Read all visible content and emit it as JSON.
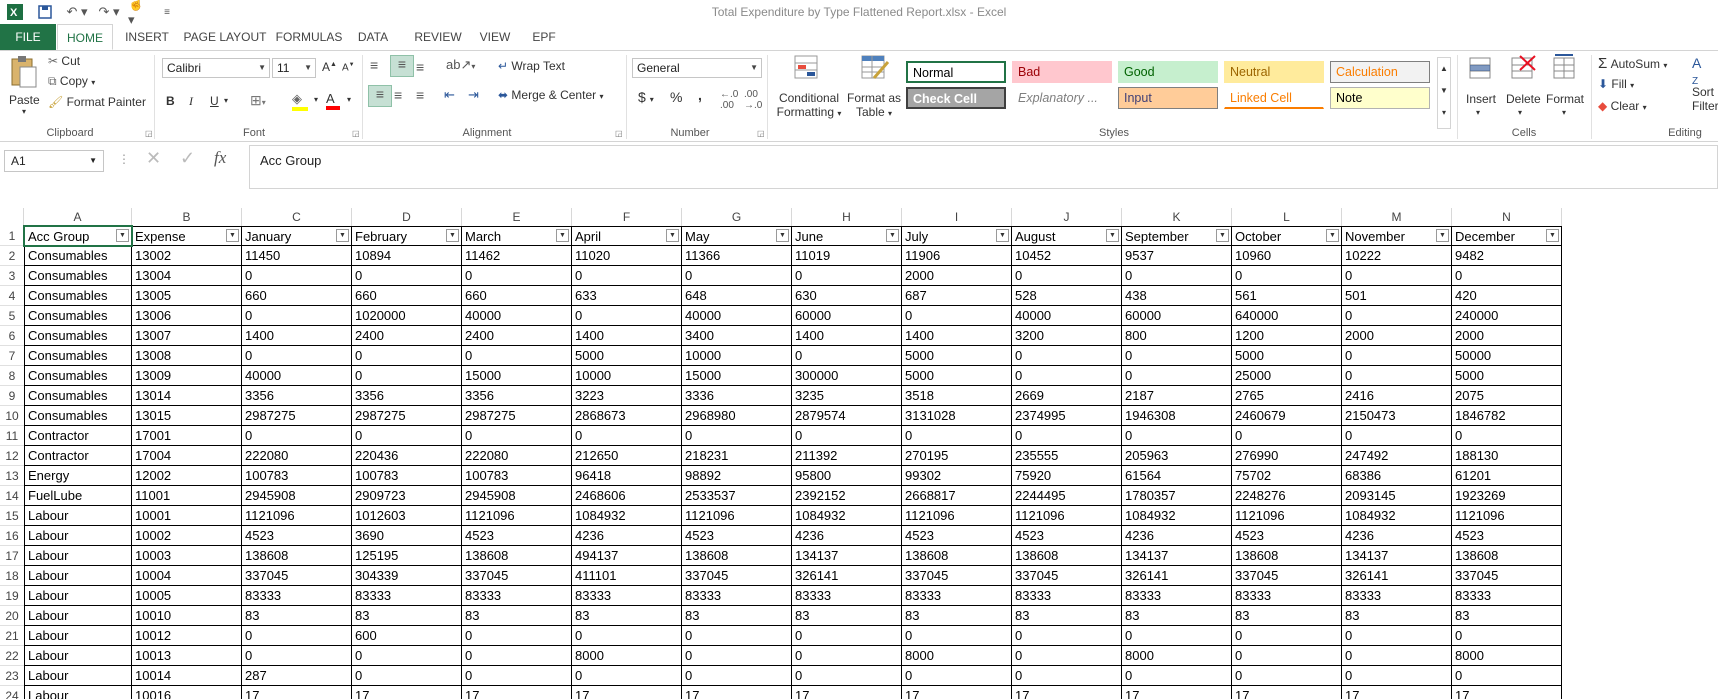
{
  "window_title": "Total Expenditure by Type Flattened Report.xlsx - Excel",
  "tabs": [
    "FILE",
    "HOME",
    "INSERT",
    "PAGE LAYOUT",
    "FORMULAS",
    "DATA",
    "REVIEW",
    "VIEW",
    "EPF"
  ],
  "clipboard": {
    "paste": "Paste",
    "cut": "Cut",
    "copy": "Copy",
    "format_painter": "Format Painter",
    "label": "Clipboard"
  },
  "font": {
    "name": "Calibri",
    "size": "11",
    "label": "Font",
    "bold": "B",
    "italic": "I",
    "underline": "U"
  },
  "alignment": {
    "wrap": "Wrap Text",
    "merge": "Merge & Center",
    "label": "Alignment"
  },
  "number": {
    "format": "General",
    "label": "Number",
    "currency": "$",
    "percent": "%",
    "comma": ","
  },
  "styles": {
    "conditional": "Conditional",
    "conditional2": "Formatting",
    "format_as": "Format as",
    "format_as2": "Table",
    "label": "Styles",
    "cells": [
      {
        "name": "Normal",
        "bg": "#ffffff",
        "fg": "#000000",
        "border": "#217346"
      },
      {
        "name": "Bad",
        "bg": "#ffc7ce",
        "fg": "#9c0006",
        "border": "#ffc7ce"
      },
      {
        "name": "Good",
        "bg": "#c6efce",
        "fg": "#006100",
        "border": "#c6efce"
      },
      {
        "name": "Neutral",
        "bg": "#ffeb9c",
        "fg": "#9c6500",
        "border": "#ffeb9c"
      },
      {
        "name": "Calculation",
        "bg": "#f2f2f2",
        "fg": "#fa7d00",
        "border": "#7f7f7f"
      },
      {
        "name": "Check Cell",
        "bg": "#a5a5a5",
        "fg": "#ffffff",
        "border": "#3f3f3f"
      },
      {
        "name": "Explanatory ...",
        "bg": "#ffffff",
        "fg": "#7f7f7f",
        "border": "#ffffff"
      },
      {
        "name": "Input",
        "bg": "#ffcc99",
        "fg": "#3f3f76",
        "border": "#7f7f7f"
      },
      {
        "name": "Linked Cell",
        "bg": "#ffffff",
        "fg": "#fa7d00",
        "border": "#ffffff"
      },
      {
        "name": "Note",
        "bg": "#ffffcc",
        "fg": "#000000",
        "border": "#b2b2b2"
      }
    ]
  },
  "cells_group": {
    "insert": "Insert",
    "delete": "Delete",
    "format": "Format",
    "label": "Cells"
  },
  "editing": {
    "autosum": "AutoSum",
    "fill": "Fill",
    "clear": "Clear",
    "sort": "Sort",
    "filter": "Filter",
    "label": "Editing"
  },
  "namebox": "A1",
  "formula": "Acc Group",
  "fx": "fx",
  "columns": [
    "A",
    "B",
    "C",
    "D",
    "E",
    "F",
    "G",
    "H",
    "I",
    "J",
    "K",
    "L",
    "M",
    "N"
  ],
  "headers": [
    "Acc Group",
    "Expense",
    "January",
    "February",
    "March",
    "April",
    "May",
    "June",
    "July",
    "August",
    "September",
    "October",
    "November",
    "December"
  ],
  "rows": [
    [
      "Consumables",
      "13002",
      "11450",
      "10894",
      "11462",
      "11020",
      "11366",
      "11019",
      "11906",
      "10452",
      "9537",
      "10960",
      "10222",
      "9482"
    ],
    [
      "Consumables",
      "13004",
      "0",
      "0",
      "0",
      "0",
      "0",
      "0",
      "2000",
      "0",
      "0",
      "0",
      "0",
      "0"
    ],
    [
      "Consumables",
      "13005",
      "660",
      "660",
      "660",
      "633",
      "648",
      "630",
      "687",
      "528",
      "438",
      "561",
      "501",
      "420"
    ],
    [
      "Consumables",
      "13006",
      "0",
      "1020000",
      "40000",
      "0",
      "40000",
      "60000",
      "0",
      "40000",
      "60000",
      "640000",
      "0",
      "240000"
    ],
    [
      "Consumables",
      "13007",
      "1400",
      "2400",
      "2400",
      "1400",
      "3400",
      "1400",
      "1400",
      "3200",
      "800",
      "1200",
      "2000",
      "2000"
    ],
    [
      "Consumables",
      "13008",
      "0",
      "0",
      "0",
      "5000",
      "10000",
      "0",
      "5000",
      "0",
      "0",
      "5000",
      "0",
      "50000"
    ],
    [
      "Consumables",
      "13009",
      "40000",
      "0",
      "15000",
      "10000",
      "15000",
      "300000",
      "5000",
      "0",
      "0",
      "25000",
      "0",
      "5000"
    ],
    [
      "Consumables",
      "13014",
      "3356",
      "3356",
      "3356",
      "3223",
      "3336",
      "3235",
      "3518",
      "2669",
      "2187",
      "2765",
      "2416",
      "2075"
    ],
    [
      "Consumables",
      "13015",
      "2987275",
      "2987275",
      "2987275",
      "2868673",
      "2968980",
      "2879574",
      "3131028",
      "2374995",
      "1946308",
      "2460679",
      "2150473",
      "1846782"
    ],
    [
      "Contractor",
      "17001",
      "0",
      "0",
      "0",
      "0",
      "0",
      "0",
      "0",
      "0",
      "0",
      "0",
      "0",
      "0"
    ],
    [
      "Contractor",
      "17004",
      "222080",
      "220436",
      "222080",
      "212650",
      "218231",
      "211392",
      "270195",
      "235555",
      "205963",
      "276990",
      "247492",
      "188130"
    ],
    [
      "Energy",
      "12002",
      "100783",
      "100783",
      "100783",
      "96418",
      "98892",
      "95800",
      "99302",
      "75920",
      "61564",
      "75702",
      "68386",
      "61201"
    ],
    [
      "FuelLube",
      "11001",
      "2945908",
      "2909723",
      "2945908",
      "2468606",
      "2533537",
      "2392152",
      "2668817",
      "2244495",
      "1780357",
      "2248276",
      "2093145",
      "1923269"
    ],
    [
      "Labour",
      "10001",
      "1121096",
      "1012603",
      "1121096",
      "1084932",
      "1121096",
      "1084932",
      "1121096",
      "1121096",
      "1084932",
      "1121096",
      "1084932",
      "1121096"
    ],
    [
      "Labour",
      "10002",
      "4523",
      "3690",
      "4523",
      "4236",
      "4523",
      "4236",
      "4523",
      "4523",
      "4236",
      "4523",
      "4236",
      "4523"
    ],
    [
      "Labour",
      "10003",
      "138608",
      "125195",
      "138608",
      "494137",
      "138608",
      "134137",
      "138608",
      "138608",
      "134137",
      "138608",
      "134137",
      "138608"
    ],
    [
      "Labour",
      "10004",
      "337045",
      "304339",
      "337045",
      "411101",
      "337045",
      "326141",
      "337045",
      "337045",
      "326141",
      "337045",
      "326141",
      "337045"
    ],
    [
      "Labour",
      "10005",
      "83333",
      "83333",
      "83333",
      "83333",
      "83333",
      "83333",
      "83333",
      "83333",
      "83333",
      "83333",
      "83333",
      "83333"
    ],
    [
      "Labour",
      "10010",
      "83",
      "83",
      "83",
      "83",
      "83",
      "83",
      "83",
      "83",
      "83",
      "83",
      "83",
      "83"
    ],
    [
      "Labour",
      "10012",
      "0",
      "600",
      "0",
      "0",
      "0",
      "0",
      "0",
      "0",
      "0",
      "0",
      "0",
      "0"
    ],
    [
      "Labour",
      "10013",
      "0",
      "0",
      "0",
      "8000",
      "0",
      "0",
      "8000",
      "0",
      "8000",
      "0",
      "0",
      "8000"
    ],
    [
      "Labour",
      "10014",
      "287",
      "0",
      "0",
      "0",
      "0",
      "0",
      "0",
      "0",
      "0",
      "0",
      "0",
      "0"
    ],
    [
      "Labour",
      "10016",
      "17",
      "17",
      "17",
      "17",
      "17",
      "17",
      "17",
      "17",
      "17",
      "17",
      "17",
      "17"
    ]
  ],
  "row_numbers": [
    "1",
    "2",
    "3",
    "4",
    "5",
    "6",
    "7",
    "8",
    "9",
    "10",
    "11",
    "12",
    "13",
    "14",
    "15",
    "16",
    "17",
    "18",
    "19",
    "20",
    "21",
    "22",
    "23",
    "24"
  ]
}
